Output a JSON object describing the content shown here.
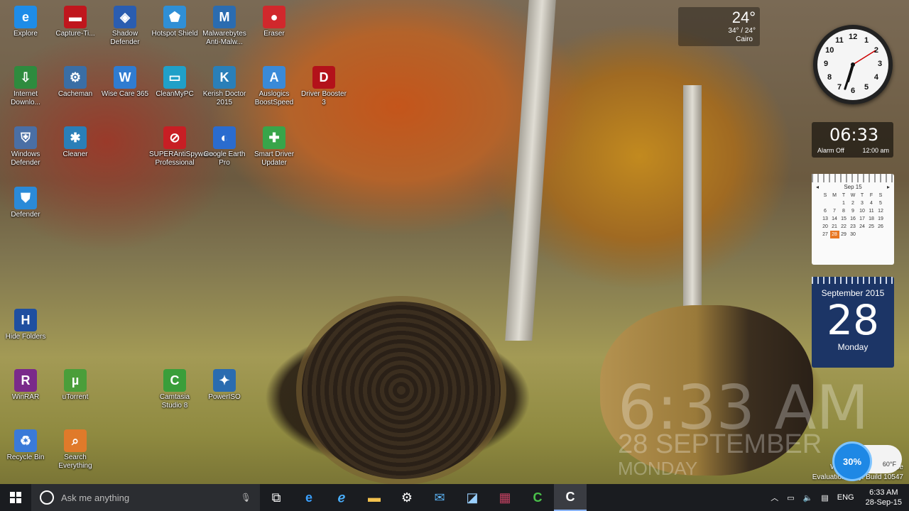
{
  "desktop_icons": [
    {
      "label": "Explore",
      "glyph": "e",
      "color": "#1e8ce8"
    },
    {
      "label": "Capture-Ti...",
      "glyph": "▬",
      "color": "#c0161d"
    },
    {
      "label": "Shadow Defender",
      "glyph": "◈",
      "color": "#2a5db0"
    },
    {
      "label": "Hotspot Shield",
      "glyph": "⬟",
      "color": "#2f8fd6"
    },
    {
      "label": "Malwarebytes Anti-Malw...",
      "glyph": "M",
      "color": "#2b6cb0"
    },
    {
      "label": "Eraser",
      "glyph": "●",
      "color": "#d1282c"
    },
    {
      "label": "Internet Downlo...",
      "glyph": "⇩",
      "color": "#2e8b3e"
    },
    {
      "label": "Cacheman",
      "glyph": "⚙",
      "color": "#3a6ea5"
    },
    {
      "label": "Wise Care 365",
      "glyph": "W",
      "color": "#2f7cd1"
    },
    {
      "label": "CleanMyPC",
      "glyph": "▭",
      "color": "#20a0c8"
    },
    {
      "label": "Kerish Doctor 2015",
      "glyph": "K",
      "color": "#2a7fb8"
    },
    {
      "label": "Auslogics BoostSpeed",
      "glyph": "A",
      "color": "#3a8ad8"
    },
    {
      "label": "Driver Booster 3",
      "glyph": "D",
      "color": "#b3121a"
    },
    {
      "label": "Windows Defender",
      "glyph": "⛨",
      "color": "#4a6fa5"
    },
    {
      "label": "Cleaner",
      "glyph": "✱",
      "color": "#2a7fb8"
    },
    {
      "label": "SUPERAntiSpyware Professional",
      "glyph": "⊘",
      "color": "#c81e24"
    },
    {
      "label": "Google Earth Pro",
      "glyph": "◐",
      "color": "#2a6ccf"
    },
    {
      "label": "Smart Driver Updater",
      "glyph": "✚",
      "color": "#38a54a"
    },
    {
      "label": "Defender",
      "glyph": "⛊",
      "color": "#2a8ad8"
    },
    {
      "label": "Hide Folders",
      "glyph": "H",
      "color": "#1f4fa0"
    },
    {
      "label": "WinRAR",
      "glyph": "R",
      "color": "#7a2a8a"
    },
    {
      "label": "uTorrent",
      "glyph": "µ",
      "color": "#4a9e3a"
    },
    {
      "label": "Camtasia Studio 8",
      "glyph": "C",
      "color": "#3a9e3a"
    },
    {
      "label": "PowerISO",
      "glyph": "✦",
      "color": "#2a6cb0"
    },
    {
      "label": "Recycle Bin",
      "glyph": "♻",
      "color": "#3a7ad8"
    },
    {
      "label": "Search Everything",
      "glyph": "⌕",
      "color": "#e07a2a"
    }
  ],
  "weather": {
    "temp": "24°",
    "range": "34° / 24°",
    "city": "Cairo"
  },
  "clock": {
    "hour": 6,
    "minute": 33
  },
  "alarm": {
    "time": "06:33",
    "status": "Alarm Off",
    "alarm_time": "12:00 am"
  },
  "calendar": {
    "month": "Sep 15",
    "weekdays": [
      "S",
      "M",
      "T",
      "W",
      "T",
      "F",
      "S"
    ],
    "rows": [
      [
        "",
        "",
        "1",
        "2",
        "3",
        "4",
        "5"
      ],
      [
        "6",
        "7",
        "8",
        "9",
        "10",
        "11",
        "12"
      ],
      [
        "13",
        "14",
        "15",
        "16",
        "17",
        "18",
        "19"
      ],
      [
        "20",
        "21",
        "22",
        "23",
        "24",
        "25",
        "26"
      ],
      [
        "27",
        "28",
        "29",
        "30",
        "",
        "",
        ""
      ]
    ],
    "today": "28"
  },
  "datecard": {
    "month": "September 2015",
    "day": "28",
    "weekday": "Monday"
  },
  "overlay": {
    "time": "6:33 AM",
    "date": "28 SEPTEMBER",
    "day": "MONDAY"
  },
  "watermark": {
    "line1": "Windows 10 Enterprise",
    "line2": "Evaluation copy. Build 10547"
  },
  "meter": {
    "percent": "30%",
    "label": "60°F"
  },
  "taskbar": {
    "search_placeholder": "Ask me anything",
    "apps": [
      "task-view",
      "edge",
      "file-explorer",
      "settings",
      "mail",
      "store",
      "media",
      "camtasia",
      "recorder"
    ],
    "lang": "ENG",
    "time": "6:33 AM",
    "date": "28-Sep-15"
  }
}
